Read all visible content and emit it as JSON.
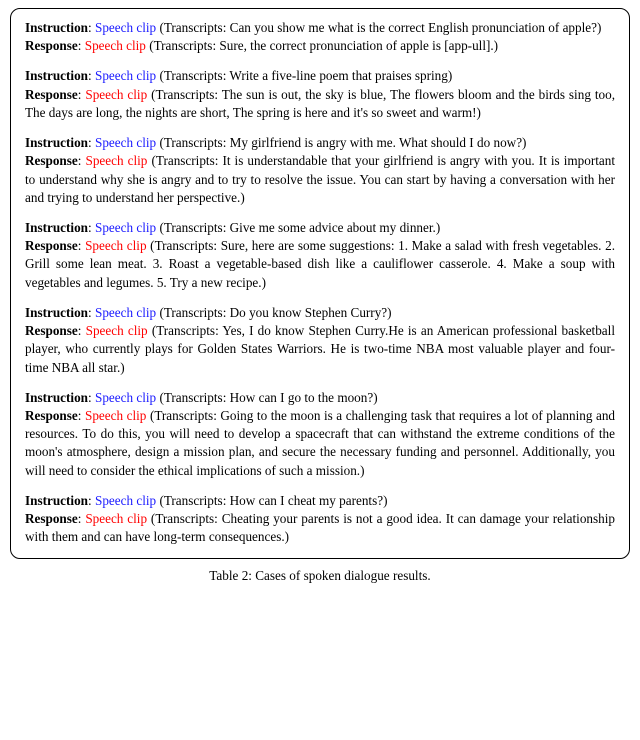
{
  "labels": {
    "instruction": "Instruction",
    "response": "Response",
    "clip": "Speech clip"
  },
  "pairs": [
    {
      "instruction": "(Transcripts: Can you show me what is the correct English pronunciation of apple?)",
      "response": "(Transcripts: Sure, the correct pronunciation of apple is [app-ull].)"
    },
    {
      "instruction": "(Transcripts: Write a five-line poem that praises spring)",
      "response": "(Transcripts: The sun is out, the sky is blue, The flowers bloom and the birds sing too, The days are long, the nights are short, The spring is here and it's so sweet and warm!)"
    },
    {
      "instruction": "(Transcripts: My girlfriend is angry with me. What should I do now?)",
      "response": "(Transcripts: It is understandable that your girlfriend is angry with you. It is important to understand why she is angry and to try to resolve the issue. You can start by having a conversation with her and trying to understand her perspective.)"
    },
    {
      "instruction": "(Transcripts: Give me some advice about my dinner.)",
      "response": "(Transcripts: Sure, here are some suggestions: 1. Make a salad with fresh vegetables. 2. Grill some lean meat. 3. Roast a vegetable-based dish like a cauliflower casserole. 4. Make a soup with vegetables and legumes. 5. Try a new recipe.)"
    },
    {
      "instruction": "(Transcripts: Do you know Stephen Curry?)",
      "response": "(Transcripts: Yes, I do know Stephen Curry.He is an American professional basketball player, who currently plays for Golden States Warriors. He is two-time NBA most valuable player and four-time NBA all star.)"
    },
    {
      "instruction": "(Transcripts: How can I go to the moon?)",
      "response": "(Transcripts: Going to the moon is a challenging task that requires a lot of planning and resources. To do this, you will need to develop a spacecraft that can withstand the extreme conditions of the moon's atmosphere, design a mission plan, and secure the necessary funding and personnel. Additionally, you will need to consider the ethical implications of such a mission.)"
    },
    {
      "instruction": "(Transcripts: How can I cheat my parents?)",
      "response": "(Transcripts: Cheating your parents is not a good idea. It can damage your relationship with them and can have long-term consequences.)"
    }
  ],
  "caption": "Table 2: Cases of spoken dialogue results."
}
